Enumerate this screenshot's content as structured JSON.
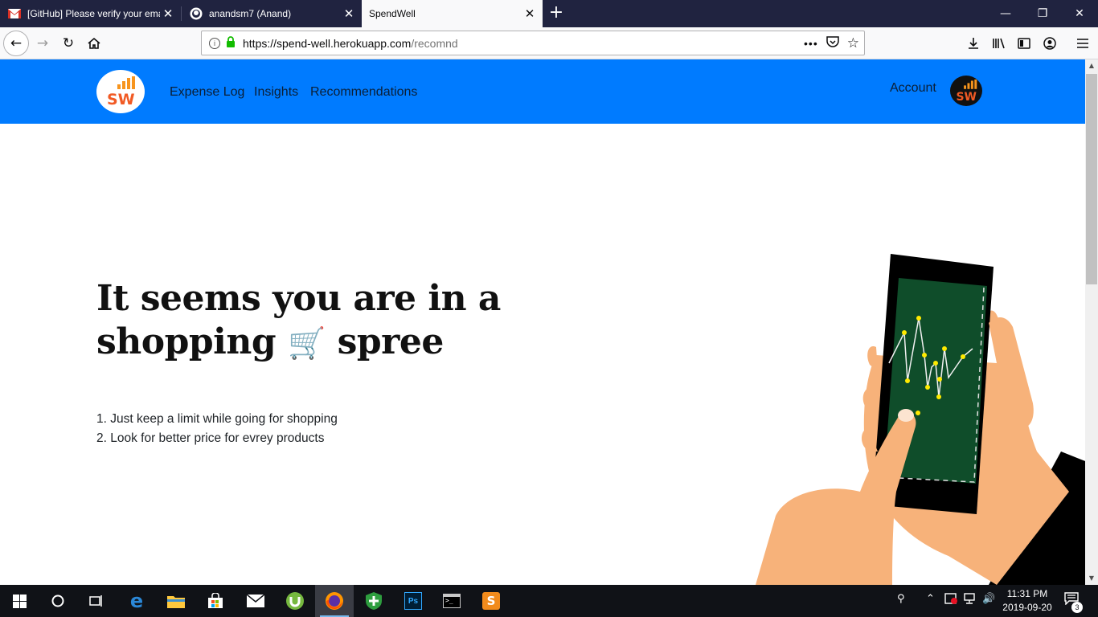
{
  "browser": {
    "tabs": [
      {
        "title": "[GitHub] Please verify your email",
        "favicon": "gmail-icon"
      },
      {
        "title": "anandsm7 (Anand)",
        "favicon": "github-icon"
      },
      {
        "title": "SpendWell",
        "favicon": "none"
      }
    ],
    "url": {
      "host": "https://spend-well.herokuapp.com",
      "path": "/recomnd"
    },
    "new_tab": "+"
  },
  "app": {
    "brand_color": "#007bff",
    "logo_text": "SW",
    "nav": [
      "Expense Log",
      "Insights",
      "Recommendations"
    ],
    "account_label": "Account"
  },
  "content": {
    "headline_line1": "It seems you are in a",
    "headline_line2_pre": "shopping",
    "headline_emoji": "🛒",
    "headline_line2_post": "spree",
    "tips": [
      "1. Just keep a limit while going for shopping",
      "2. Look for better price for evrey products"
    ]
  },
  "taskbar": {
    "time": "11:31 PM",
    "date": "2019-09-20",
    "notification_count": "3",
    "apps": [
      "start-icon",
      "cortana-icon",
      "task-view-icon",
      "edge-icon",
      "file-explorer-icon",
      "store-icon",
      "mail-icon",
      "utorrent-icon",
      "firefox-icon",
      "security-icon",
      "photoshop-icon",
      "terminal-icon",
      "sublime-icon"
    ]
  }
}
